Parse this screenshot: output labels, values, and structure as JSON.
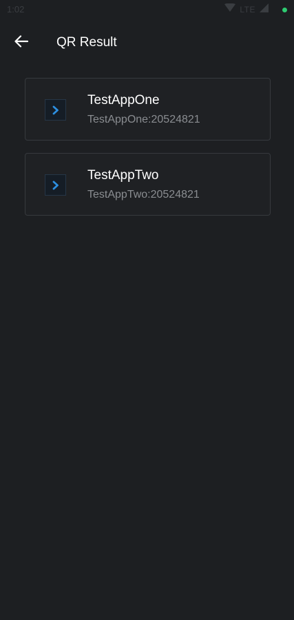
{
  "status_bar": {
    "time": "1:02",
    "network": "LTE"
  },
  "app_bar": {
    "title": "QR Result",
    "back_icon": "arrow-left-icon"
  },
  "results": [
    {
      "title": "TestAppOne",
      "subtitle": "TestAppOne:20524821",
      "icon": "chevron-right-icon"
    },
    {
      "title": "TestAppTwo",
      "subtitle": "TestAppTwo:20524821",
      "icon": "chevron-right-icon"
    }
  ],
  "colors": {
    "background": "#1d1f22",
    "card_border": "#373a3e",
    "accent": "#2d8fe0",
    "status_dot": "#2ecc71",
    "subtitle": "#8a8d91"
  }
}
